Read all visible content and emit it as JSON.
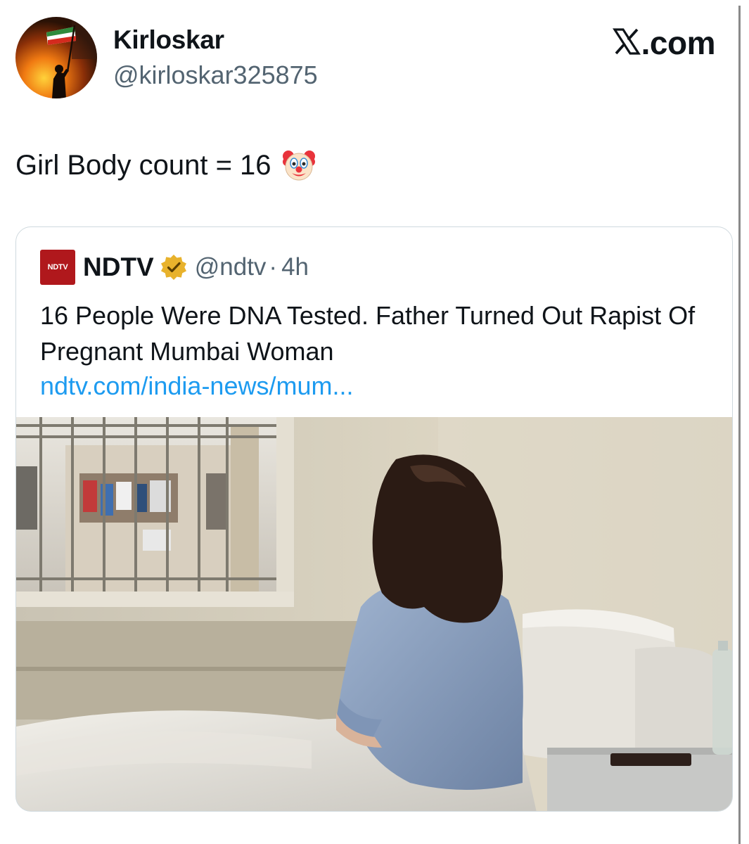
{
  "tweet": {
    "author": {
      "name": "Kirloskar",
      "handle": "@kirloskar325875"
    },
    "brand": ".com",
    "text": "Girl Body count = 16",
    "emoji_icon": "clown-face-icon",
    "quoted": {
      "author_name": "NDTV",
      "logo_text": "NDTV",
      "verified_icon": "verified-gold-badge-icon",
      "handle": "@ndtv",
      "separator": "·",
      "time": "4h",
      "text": "16 People Were DNA Tested. Father Turned Out Rapist Of Pregnant Mumbai Woman",
      "link": "ndtv.com/india-news/mum..."
    }
  },
  "colors": {
    "text": "#0f1419",
    "secondary": "#536471",
    "link": "#1d9bf0",
    "ndtv_red": "#b0181c",
    "badge_gold": "#e8b22c"
  }
}
